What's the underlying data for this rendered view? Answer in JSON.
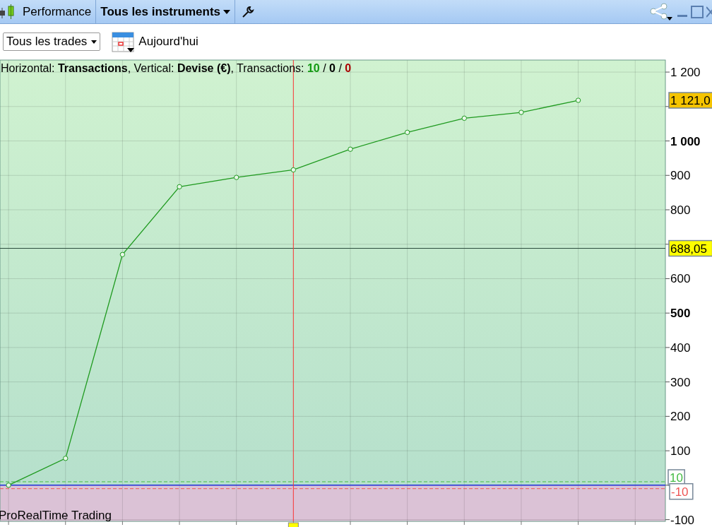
{
  "toolbar": {
    "items": [
      {
        "kind": "tab",
        "label": "Performance",
        "selected": false
      },
      {
        "kind": "dropdown",
        "label": "Tous les instruments",
        "selected": true
      },
      {
        "kind": "tool"
      }
    ]
  },
  "filters": {
    "trade_filter": "Tous les trades",
    "date": "Aujourd'hui"
  },
  "legend": [
    {
      "text": "Horizontal: **Transactions**, Vertical: **Devise (€)**, Transactions: "
    },
    {
      "text": "10",
      "color": "#119911"
    },
    {
      "text": " / "
    },
    {
      "text": "0",
      "color": "#000000"
    },
    {
      "text": " / "
    },
    {
      "text": "0",
      "color": "#aa0000"
    }
  ],
  "chart_data": {
    "type": "line",
    "categories": [
      null,
      null,
      null,
      null,
      null,
      null,
      null,
      null,
      null,
      null,
      null
    ],
    "series": [
      {
        "color": "#1f9a1f",
        "marker": "o",
        "values": [
          0,
          78,
          670,
          867,
          894,
          916,
          976,
          1025,
          1066,
          1083,
          1118
        ]
      }
    ],
    "ylim": [
      -105,
      1235
    ],
    "grid": true,
    "ref_lines": [
      {
        "axis": "y",
        "value": 688.05,
        "color": "#2a4a3a"
      },
      {
        "axis": "y",
        "value": 10,
        "color": "#44bb44"
      },
      {
        "axis": "y",
        "value": 0,
        "color": "#2233dd"
      },
      {
        "axis": "y",
        "value": -10,
        "color": "#ee5555"
      }
    ],
    "bands": [
      {
        "axis": "y",
        "from": -105,
        "to": 0,
        "color": "#dbc2d6"
      }
    ],
    "yticks": [
      {
        "value": 1200,
        "label": "1 200"
      },
      {
        "value": 1000,
        "label": "1 000"
      },
      {
        "value": 900,
        "label": "900"
      },
      {
        "value": 800,
        "label": "800"
      },
      {
        "value": 600,
        "label": "600"
      },
      {
        "value": 500,
        "label": "500"
      },
      {
        "value": 400,
        "label": "400"
      },
      {
        "value": 300,
        "label": "300"
      },
      {
        "value": 200,
        "label": "200"
      },
      {
        "value": 100,
        "label": "100"
      },
      {
        "value": -100,
        "label": "-100"
      }
    ]
  },
  "badges": [
    {
      "kind": "last",
      "label": "1 121,0",
      "color": "#f5c400"
    },
    {
      "kind": "level",
      "label": "688,05",
      "color": "#ffff00"
    },
    {
      "kind": "limit",
      "label": "10",
      "color": "#44bb44"
    },
    {
      "kind": "limit",
      "label": "-10",
      "color": "#ee5555"
    }
  ],
  "crosshair": {
    "shown": true
  },
  "footer": "ProRealTime Trading"
}
